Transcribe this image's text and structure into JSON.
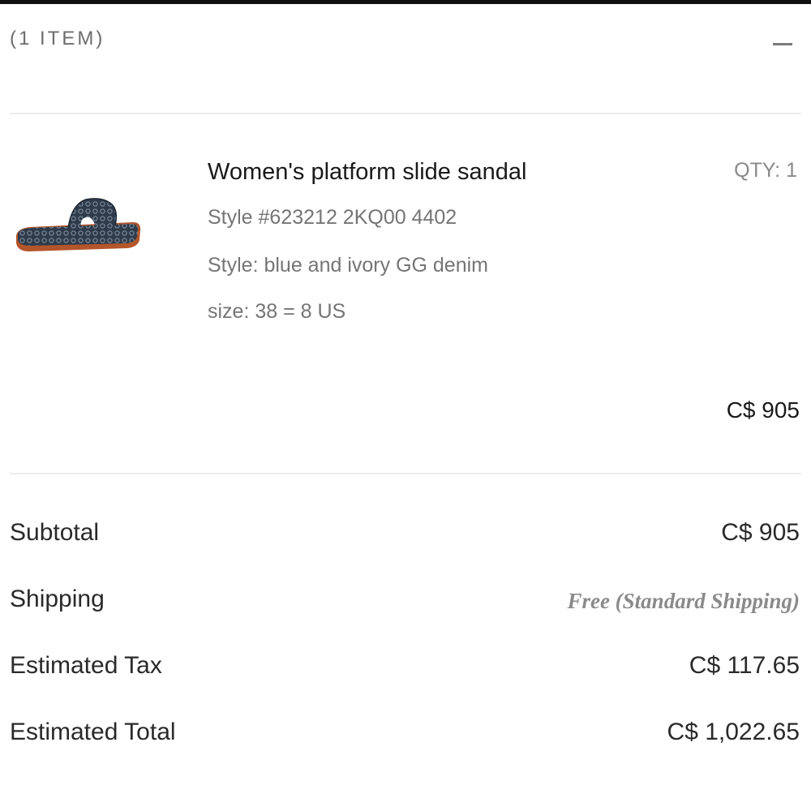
{
  "cart": {
    "item_count_label": "(1 ITEM)"
  },
  "icons": {
    "collapse": "minus-icon"
  },
  "item": {
    "name": "Women's platform slide sandal",
    "qty_label": "QTY:",
    "qty_value": "1",
    "style_number": "Style #623212 2KQ00 4402",
    "style_desc": "Style: blue and ivory GG denim",
    "size": "size: 38 = 8 US",
    "price": "C$ 905",
    "image": "platform-slide-sandal-thumbnail"
  },
  "summary": {
    "subtotal_label": "Subtotal",
    "subtotal_value": "C$ 905",
    "shipping_label": "Shipping",
    "shipping_value": "Free (Standard Shipping)",
    "tax_label": "Estimated Tax",
    "tax_value": "C$ 117.65",
    "total_label": "Estimated Total",
    "total_value": "C$ 1,022.65"
  },
  "colors": {
    "text_primary": "#1a1a1a",
    "text_secondary": "#757575",
    "divider": "#ececec",
    "top_bar": "#111111"
  }
}
